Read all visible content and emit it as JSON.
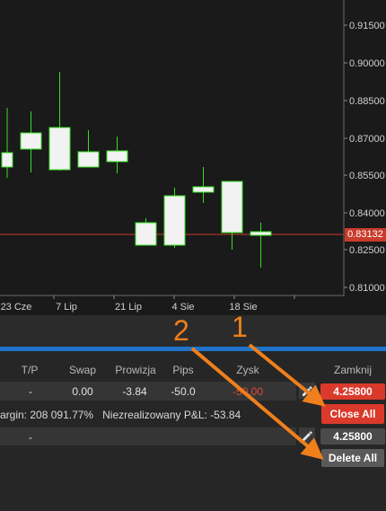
{
  "chart": {
    "price_labels": [
      "0.91500",
      "0.90000",
      "0.88500",
      "0.87000",
      "0.85500",
      "0.84000",
      "0.82500",
      "0.81000"
    ],
    "current_price": "0.83132",
    "date_labels": [
      "23 Cze",
      "7 Lip",
      "21 Lip",
      "4 Sie",
      "18 Sie"
    ]
  },
  "positions": {
    "headers": {
      "tp": "T/P",
      "swap": "Swap",
      "commission": "Prowizja",
      "pips": "Pips",
      "profit": "Zysk",
      "close": "Zamknij"
    },
    "row1": {
      "tp": "-",
      "swap": "0.00",
      "commission": "-3.84",
      "pips": "-50.0",
      "profit": "-50.00",
      "close_price": "4.25800"
    },
    "close_all_label": "Close All",
    "summary": {
      "margin_label": "argin:",
      "margin_value": "208 091.77%",
      "pnl_label": "Niezrealizowany P&L:",
      "pnl_value": "-53.84"
    },
    "row3": {
      "tp": "-",
      "close_price": "4.25800"
    },
    "delete_all_label": "Delete All"
  },
  "annotations": {
    "one": "1",
    "two": "2"
  },
  "colors": {
    "candle_outline": "#31e01e",
    "price_line": "#c93b2a",
    "profit_negative": "#e24b35",
    "accent_blue": "#1f74c9",
    "close_red": "#d93a2b",
    "arrow_orange": "#f07f1c"
  }
}
